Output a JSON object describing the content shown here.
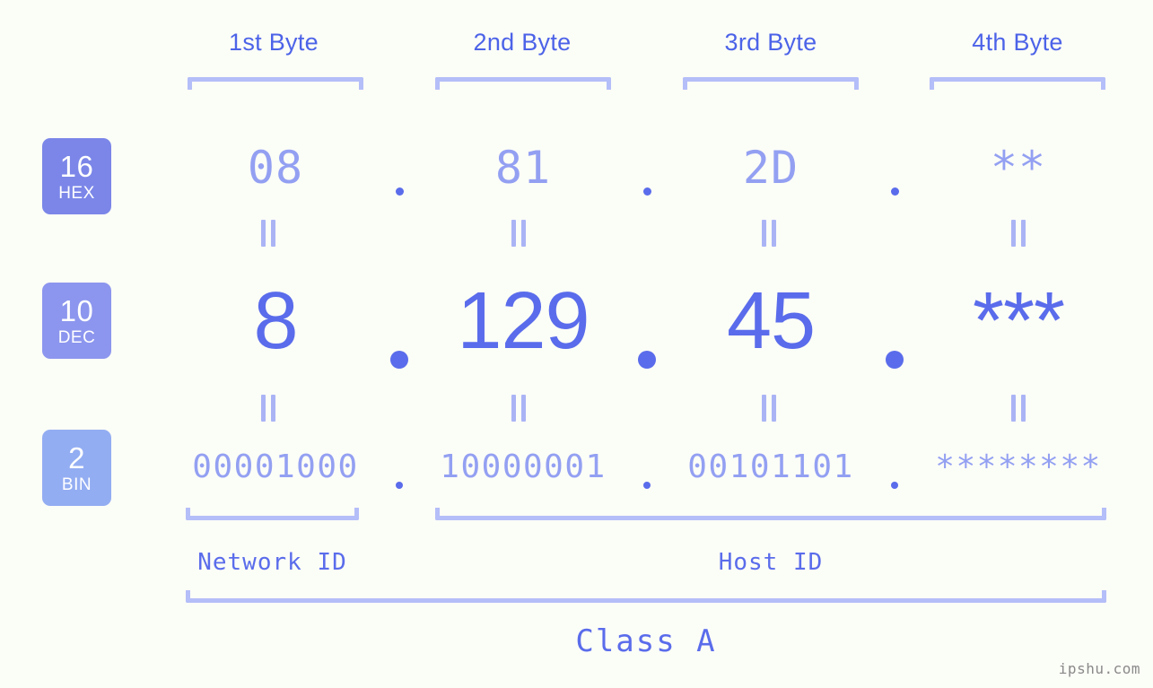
{
  "background_color": "#fbfdf7",
  "accent_colors": {
    "strong_blue": "#5a6ceb",
    "light_blue": "#93a0f2",
    "bracket_blue": "#b4bef8",
    "connector_blue": "#aab4f5",
    "hex_badge": "#7b86e8",
    "dec_badge": "#8c96ee",
    "bin_badge": "#93adf2",
    "watermark_gray": "#8a8a8a"
  },
  "byte_headers": [
    {
      "label": "1st Byte"
    },
    {
      "label": "2nd Byte"
    },
    {
      "label": "3rd Byte"
    },
    {
      "label": "4th Byte"
    }
  ],
  "rows": {
    "hex": {
      "badge_number": "16",
      "badge_abbr": "HEX",
      "values": [
        "08",
        "81",
        "2D",
        "**"
      ],
      "separator": "."
    },
    "dec": {
      "badge_number": "10",
      "badge_abbr": "DEC",
      "values": [
        "8",
        "129",
        "45",
        "***"
      ],
      "separator": "."
    },
    "bin": {
      "badge_number": "2",
      "badge_abbr": "BIN",
      "values": [
        "00001000",
        "10000001",
        "00101101",
        "********"
      ],
      "separator": "."
    }
  },
  "connector_symbol": "||",
  "id_sections": [
    {
      "label": "Network ID"
    },
    {
      "label": "Host ID"
    }
  ],
  "class_label": "Class A",
  "watermark": "ipshu.com"
}
